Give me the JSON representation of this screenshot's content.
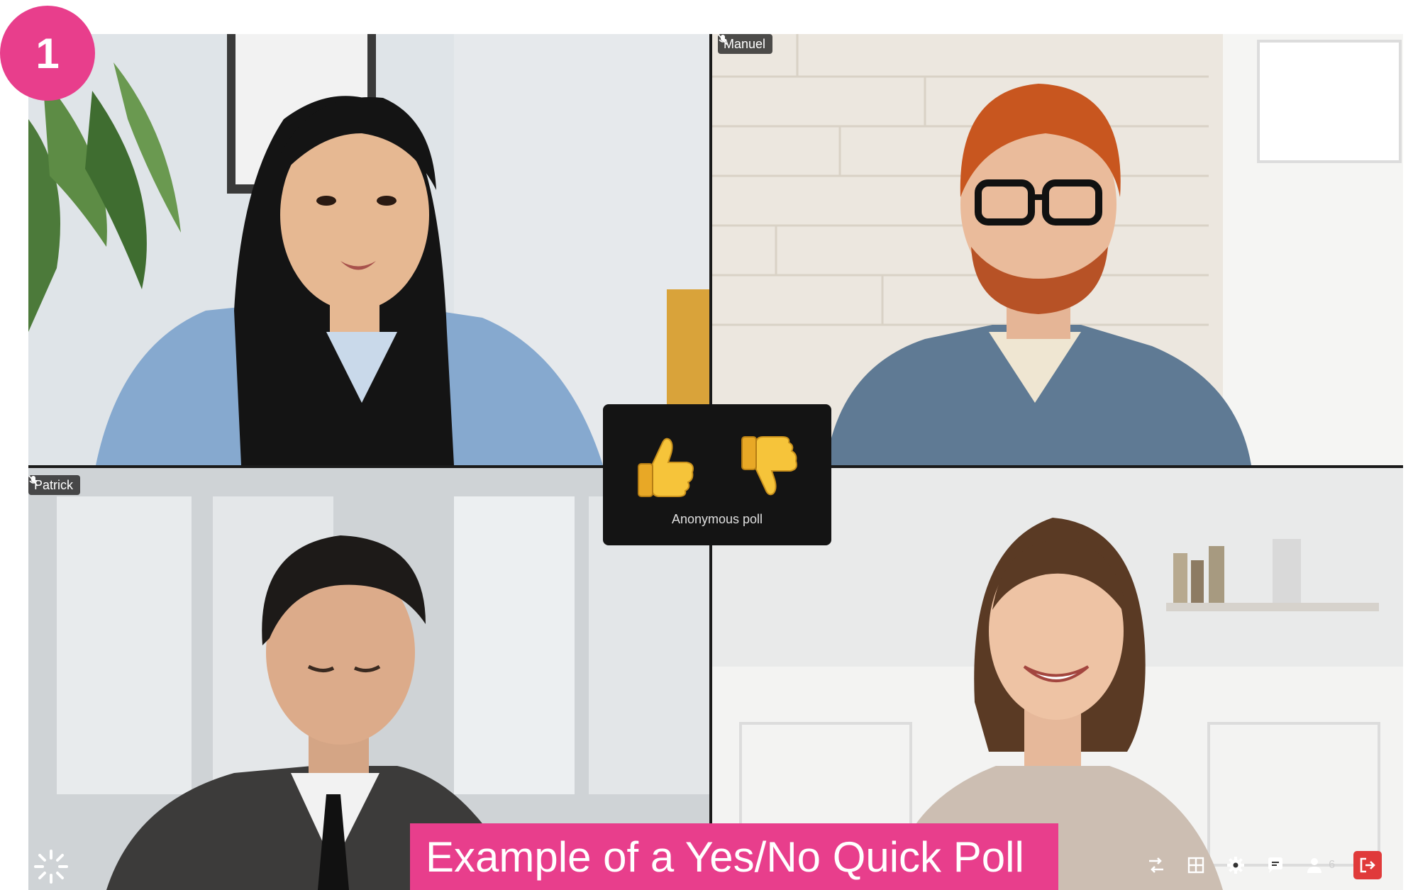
{
  "step_badge": "1",
  "participants": [
    {
      "name": ""
    },
    {
      "name": "Manuel"
    },
    {
      "name": "Patrick"
    },
    {
      "name": ""
    }
  ],
  "poll": {
    "yes_icon": "thumbs-up-icon",
    "no_icon": "thumbs-down-icon",
    "label": "Anonymous poll"
  },
  "caption": "Example of a Yes/No Quick Poll",
  "toolbar": {
    "participant_count": "6",
    "icons": [
      "switch-view-icon",
      "grid-layout-icon",
      "settings-gear-icon",
      "chat-icon",
      "participants-icon",
      "leave-icon"
    ]
  },
  "colors": {
    "accent": "#e83e8c",
    "leave": "#e03a3a",
    "poll_bg": "#141414"
  }
}
